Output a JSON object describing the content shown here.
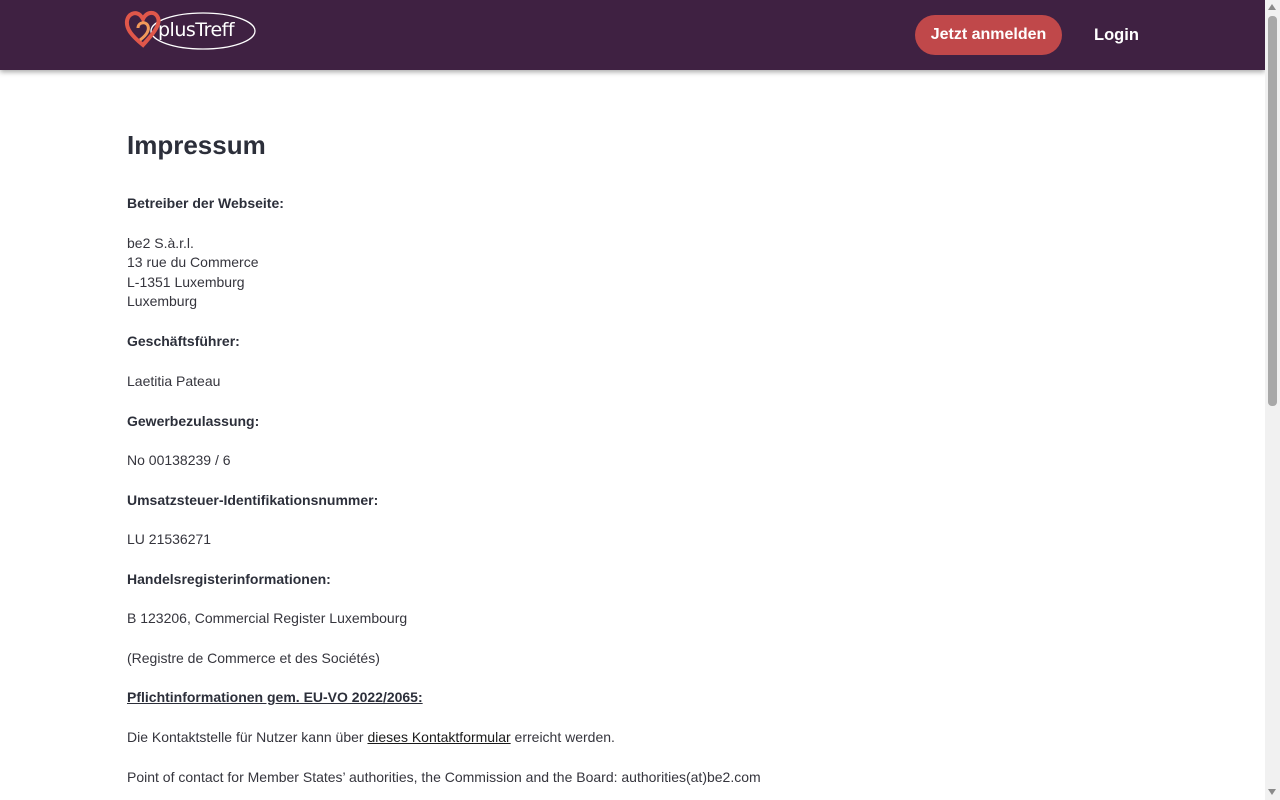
{
  "header": {
    "logo_text": "plusTreff",
    "signup_label": "Jetzt anmelden",
    "login_label": "Login",
    "background_color": "#3f2142",
    "accent_color": "#c0484a"
  },
  "impressum": {
    "title": "Impressum",
    "operator_heading": "Betreiber der Webseite:",
    "address": [
      "be2 S.à.r.l.",
      "13 rue du Commerce",
      "L-1351 Luxemburg",
      "Luxemburg"
    ],
    "ceo_heading": "Geschäftsführer:",
    "ceo_name": "Laetitia Pateau",
    "license_heading": "Gewerbezulassung:",
    "license_value": "No 00138239 / 6",
    "vat_heading": "Umsatzsteuer-Identifikationsnummer:",
    "vat_value": "LU 21536271",
    "register_heading": "Handelsregisterinformationen:",
    "register_value": "B 123206, Commercial Register Luxembourg",
    "register_note": "(Registre de Commerce et des Sociétés)",
    "eu_heading": "Pflichtinformationen gem. EU-VO 2022/2065:",
    "contact_prefix": "Die Kontaktstelle für Nutzer kann über ",
    "contact_link": "dieses Kontaktformular",
    "contact_suffix": " erreicht werden.",
    "authorities_text": "Point of contact for Member States’ authorities, the Commission and the Board: authorities(at)be2.com"
  }
}
